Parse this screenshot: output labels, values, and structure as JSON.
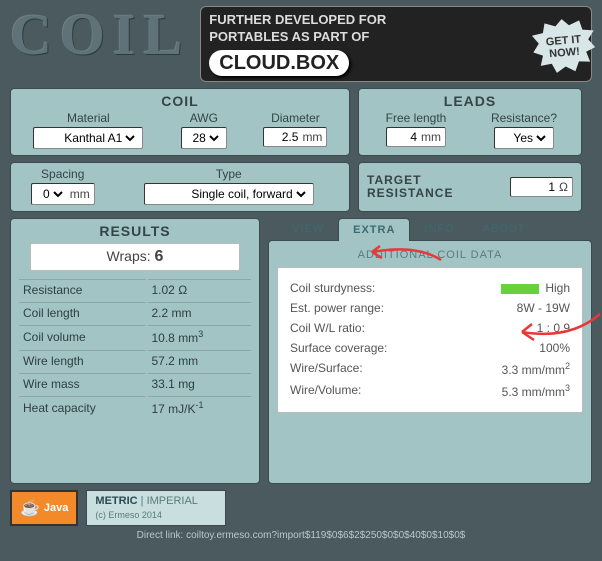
{
  "logo": "COIL",
  "promo": {
    "line1": "FURTHER DEVELOPED FOR",
    "line2": "PORTABLES AS PART OF",
    "brand": "CLOUD.BOX",
    "cta": "GET IT NOW!"
  },
  "coil": {
    "title": "COIL",
    "material": {
      "lbl": "Material",
      "val": "Kanthal A1"
    },
    "awg": {
      "lbl": "AWG",
      "val": "28"
    },
    "diameter": {
      "lbl": "Diameter",
      "val": "2.5",
      "unit": "mm"
    },
    "spacing": {
      "lbl": "Spacing",
      "val": "0",
      "unit": "mm"
    },
    "type": {
      "lbl": "Type",
      "val": "Single coil, forward"
    }
  },
  "leads": {
    "title": "LEADS",
    "freelen": {
      "lbl": "Free length",
      "val": "4",
      "unit": "mm"
    },
    "res": {
      "lbl": "Resistance?",
      "val": "Yes"
    }
  },
  "target": {
    "lbl1": "TARGET",
    "lbl2": "RESISTANCE",
    "val": "1",
    "unit": "Ω"
  },
  "results": {
    "title": "RESULTS",
    "wraps_lbl": "Wraps:",
    "wraps": "6",
    "rows": [
      {
        "k": "Resistance",
        "v": "1.02 Ω"
      },
      {
        "k": "Coil length",
        "v": "2.2 mm"
      },
      {
        "k": "Coil volume",
        "v": "10.8 mm",
        "sup": "3"
      },
      {
        "k": "Wire length",
        "v": "57.2 mm"
      },
      {
        "k": "Wire mass",
        "v": "33.1 mg"
      },
      {
        "k": "Heat capacity",
        "v": "17 mJ/K",
        "sup": "-1"
      }
    ]
  },
  "tabs": {
    "view": "VIEW",
    "extra": "EXTRA",
    "info": "INFO",
    "about": "ABOUT",
    "sub": "ADDITIONAL COIL DATA"
  },
  "extra": {
    "sturdy": {
      "k": "Coil sturdyness:",
      "v": "High"
    },
    "power": {
      "k": "Est. power range:",
      "v": "8W - 19W"
    },
    "ratio": {
      "k": "Coil W/L ratio:",
      "v": "1 : 0.9"
    },
    "cover": {
      "k": "Surface coverage:",
      "v": "100%"
    },
    "wsurf": {
      "k": "Wire/Surface:",
      "v": "3.3 mm/mm",
      "sup": "2"
    },
    "wvol": {
      "k": "Wire/Volume:",
      "v": "5.3 mm/mm",
      "sup": "3"
    }
  },
  "footer": {
    "java": "Java",
    "metric": "METRIC",
    "imperial": "IMPERIAL",
    "cp": "(c) Ermeso 2014"
  },
  "direct": "Direct link: coiltoy.ermeso.com?import$119$0$6$2$250$0$0$40$0$10$0$"
}
